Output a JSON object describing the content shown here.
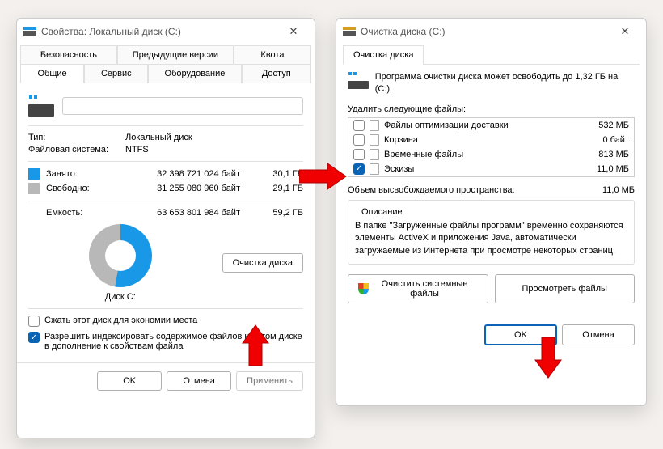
{
  "leftWindow": {
    "title": "Свойства: Локальный диск (C:)",
    "tabsRow1": [
      "Безопасность",
      "Предыдущие версии",
      "Квота"
    ],
    "tabsRow2": [
      "Общие",
      "Сервис",
      "Оборудование",
      "Доступ"
    ],
    "diskNameValue": "",
    "typeLabel": "Тип:",
    "typeValue": "Локальный диск",
    "fsLabel": "Файловая система:",
    "fsValue": "NTFS",
    "usedLabel": "Занято:",
    "usedBytes": "32 398 721 024 байт",
    "usedGb": "30,1 ГБ",
    "freeLabel": "Свободно:",
    "freeBytes": "31 255 080 960 байт",
    "freeGb": "29,1 ГБ",
    "capLabel": "Емкость:",
    "capBytes": "63 653 801 984 байт",
    "capGb": "59,2 ГБ",
    "diskLabel": "Диск C:",
    "cleanupBtn": "Очистка диска",
    "compressLabel": "Сжать этот диск для экономии места",
    "indexLabel": "Разрешить индексировать содержимое файлов на этом диске в дополнение к свойствам файла",
    "okBtn": "OK",
    "cancelBtn": "Отмена",
    "applyBtn": "Применить"
  },
  "rightWindow": {
    "title": "Очистка диска  (C:)",
    "tab": "Очистка диска",
    "info": "Программа очистки диска может освободить до 1,32 ГБ на  (C:).",
    "deleteLabel": "Удалить следующие файлы:",
    "files": [
      {
        "name": "Файлы оптимизации доставки",
        "size": "532 МБ",
        "checked": false
      },
      {
        "name": "Корзина",
        "size": "0 байт",
        "checked": false
      },
      {
        "name": "Временные файлы",
        "size": "813 МБ",
        "checked": false
      },
      {
        "name": "Эскизы",
        "size": "11,0 МБ",
        "checked": true
      }
    ],
    "freeSpaceLabel": "Объем высвобождаемого пространства:",
    "freeSpaceValue": "11,0 МБ",
    "descLegend": "Описание",
    "descText": "В папке \"Загруженные файлы программ\" временно сохраняются элементы ActiveX и приложения Java, автоматически загружаемые из Интернета при просмотре некоторых страниц.",
    "cleanSysBtn": "Очистить системные файлы",
    "viewFilesBtn": "Просмотреть файлы",
    "okBtn": "OK",
    "cancelBtn": "Отмена"
  },
  "colors": {
    "accent": "#1a98e8",
    "arrow": "#f00000"
  }
}
